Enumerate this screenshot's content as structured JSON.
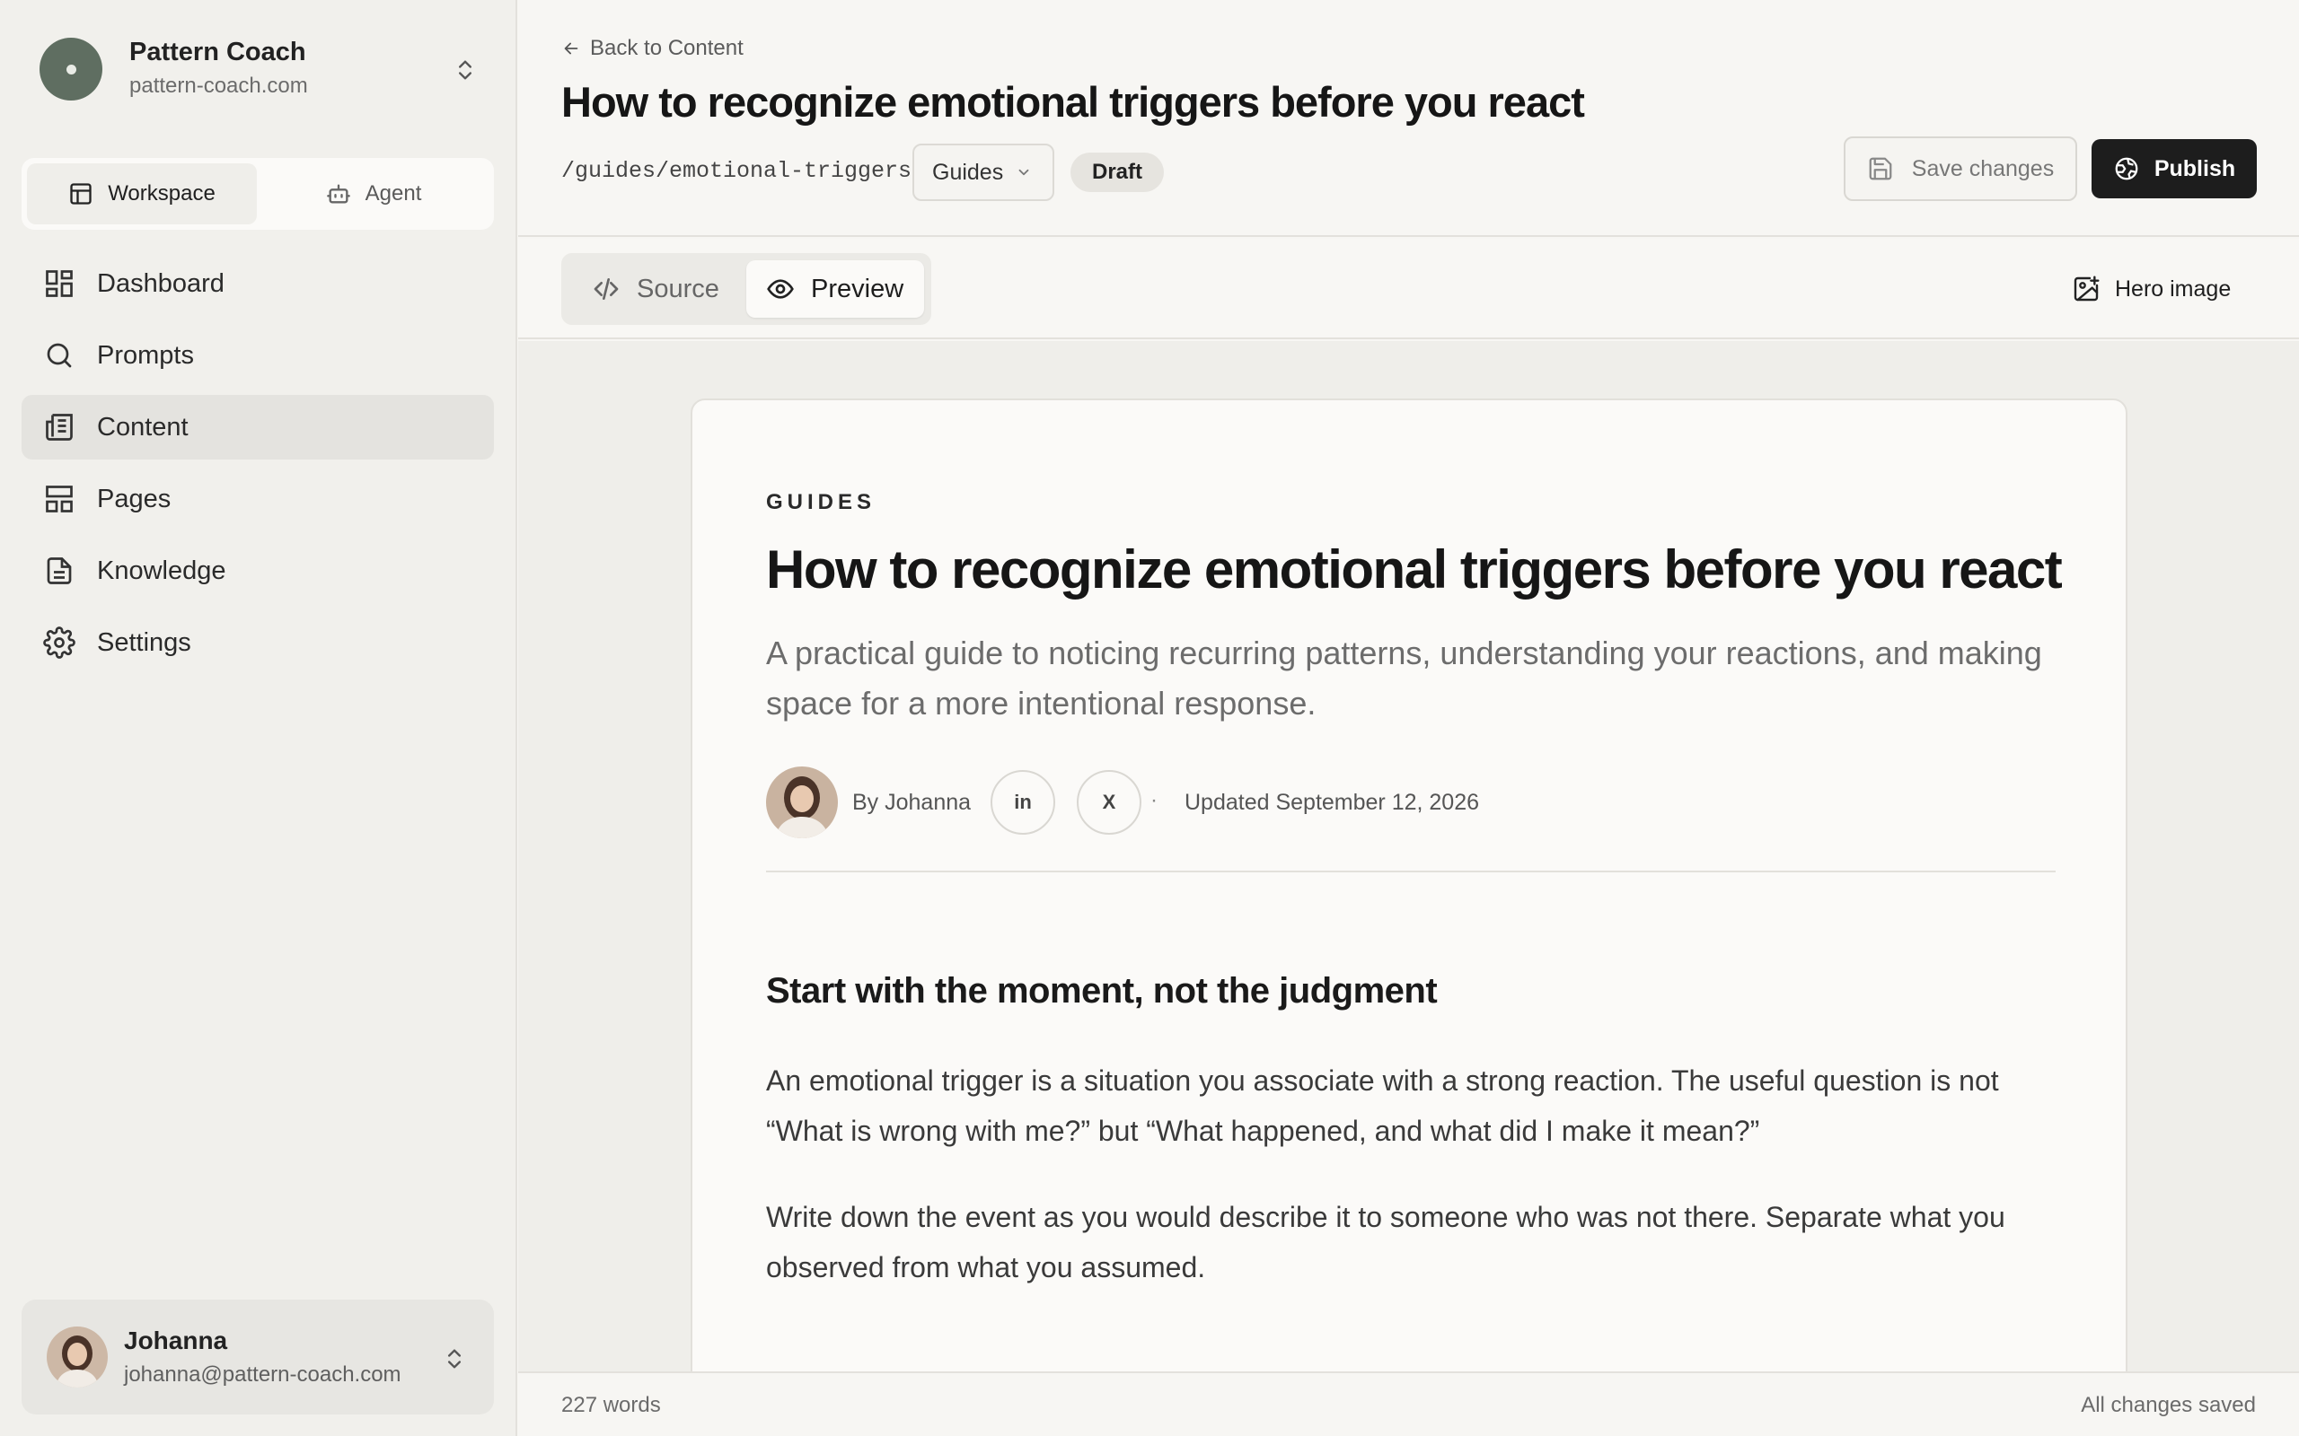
{
  "sidebar": {
    "org_name": "Pattern Coach",
    "org_domain": "pattern-coach.com",
    "switcher": {
      "workspace": "Workspace",
      "agent": "Agent",
      "active": "workspace"
    },
    "items": [
      {
        "label": "Dashboard",
        "icon": "dashboard-icon"
      },
      {
        "label": "Prompts",
        "icon": "search-icon"
      },
      {
        "label": "Content",
        "icon": "newspaper-icon",
        "active": true
      },
      {
        "label": "Pages",
        "icon": "layout-icon"
      },
      {
        "label": "Knowledge",
        "icon": "document-icon"
      },
      {
        "label": "Settings",
        "icon": "gear-icon"
      }
    ],
    "user": {
      "name": "Johanna",
      "email": "johanna@pattern-coach.com"
    }
  },
  "header": {
    "back_label": "Back to Content",
    "title": "How to recognize emotional triggers before you react",
    "slug": "/guides/emotional-triggers",
    "category": "Guides",
    "status": "Draft",
    "save_label": "Save changes",
    "publish_label": "Publish"
  },
  "toolbar": {
    "source_label": "Source",
    "preview_label": "Preview",
    "active_view": "preview",
    "hero_label": "Hero image"
  },
  "article": {
    "eyebrow": "GUIDES",
    "title": "How to recognize emotional triggers before you react",
    "subtitle": "A practical guide to noticing recurring patterns, understanding your reactions, and making space for a more intentional response.",
    "author": "By Johanna",
    "social": [
      "in",
      "X"
    ],
    "separator": "·",
    "updated": "Updated September 12, 2026",
    "heading": "Start with the moment, not the judgment",
    "paragraphs": [
      "An emotional trigger is a situation you associate with a strong reaction. The useful question is not “What is wrong with me?” but “What happened, and what did I make it mean?”",
      "Write down the event as you would describe it to someone who was not there. Separate what you observed from what you assumed."
    ]
  },
  "footer": {
    "word_count": "227 words",
    "save_status": "All changes saved"
  },
  "colors": {
    "sidebar_bg": "#f1f0ec",
    "accent_dark": "#1d1d1d",
    "org_logo": "#5f6e61"
  }
}
